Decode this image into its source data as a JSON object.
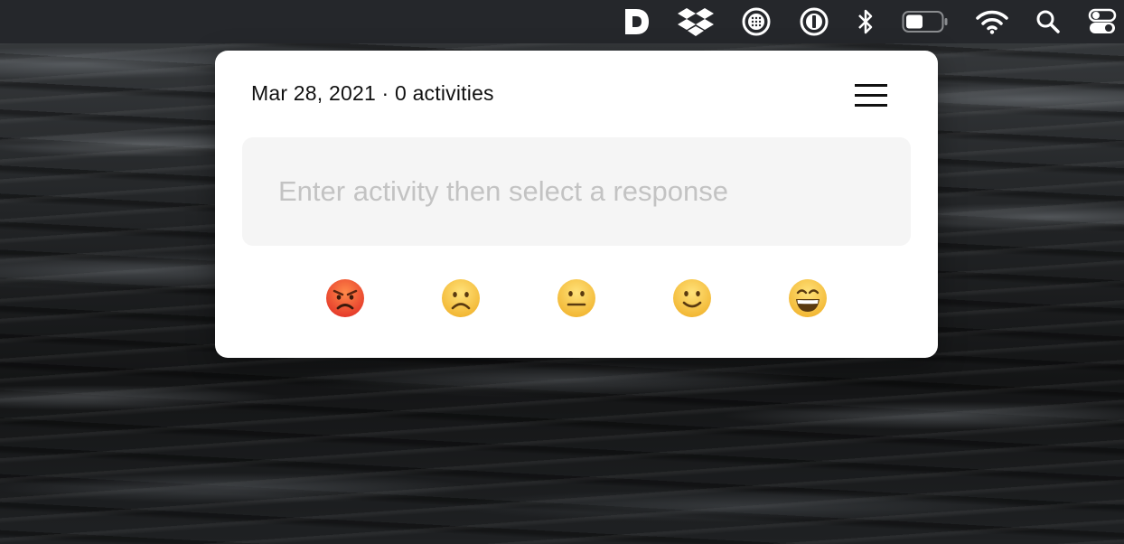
{
  "menubar": {
    "items": [
      {
        "icon": "day-one-d-icon"
      },
      {
        "icon": "dropbox-icon"
      },
      {
        "icon": "globe-dotted-icon"
      },
      {
        "icon": "onepassword-icon"
      },
      {
        "icon": "bluetooth-icon"
      },
      {
        "icon": "battery-icon"
      },
      {
        "icon": "wifi-icon"
      },
      {
        "icon": "spotlight-search-icon"
      },
      {
        "icon": "control-center-icon"
      }
    ]
  },
  "popover": {
    "date": "Mar 28, 2021",
    "separator": "·",
    "activity_count": "0 activities",
    "menu_icon": "hamburger-menu-icon",
    "input": {
      "placeholder": "Enter activity then select a response",
      "value": ""
    },
    "responses": [
      {
        "name": "angry",
        "icon": "angry-face-icon"
      },
      {
        "name": "frowning",
        "icon": "frowning-face-icon"
      },
      {
        "name": "neutral",
        "icon": "neutral-face-icon"
      },
      {
        "name": "slightly-smiling",
        "icon": "slightly-smiling-face-icon"
      },
      {
        "name": "grinning",
        "icon": "grinning-face-icon"
      }
    ]
  },
  "colors": {
    "menubar_bg": "#25272b",
    "popover_bg": "#ffffff",
    "input_bg": "#f5f5f5",
    "placeholder": "#c3c3c3",
    "emoji_yellow": "#fbd04c",
    "emoji_angry": "#f2553a"
  }
}
